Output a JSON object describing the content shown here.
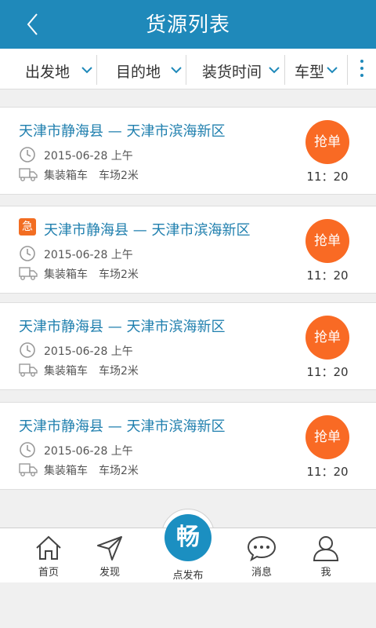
{
  "header": {
    "title": "货源列表",
    "back_icon": "chevron-left-icon"
  },
  "filters": [
    {
      "label": "出发地"
    },
    {
      "label": "目的地"
    },
    {
      "label": "装货时间"
    },
    {
      "label": "车型"
    }
  ],
  "cards": [
    {
      "urgent": "",
      "route": "天津市静海县 — 天津市滨海新区",
      "date": "2015-06-28 上午",
      "vehicle": "集装箱车",
      "yard": "车场2米",
      "grab": "抢单",
      "time": "11：20"
    },
    {
      "urgent": "急",
      "route": "天津市静海县 — 天津市滨海新区",
      "date": "2015-06-28 上午",
      "vehicle": "集装箱车",
      "yard": "车场2米",
      "grab": "抢单",
      "time": "11：20"
    },
    {
      "urgent": "",
      "route": "天津市静海县 — 天津市滨海新区",
      "date": "2015-06-28 上午",
      "vehicle": "集装箱车",
      "yard": "车场2米",
      "grab": "抢单",
      "time": "11：20"
    },
    {
      "urgent": "",
      "route": "天津市静海县 — 天津市滨海新区",
      "date": "2015-06-28 上午",
      "vehicle": "集装箱车",
      "yard": "车场2米",
      "grab": "抢单",
      "time": "11：20"
    }
  ],
  "tabbar": {
    "home": "首页",
    "discover": "发现",
    "publish_icon_text": "畅",
    "publish": "点发布",
    "messages": "消息",
    "me": "我"
  },
  "colors": {
    "primary": "#1f89ba",
    "accent": "#f96a24",
    "urgent": "#f26d22"
  }
}
